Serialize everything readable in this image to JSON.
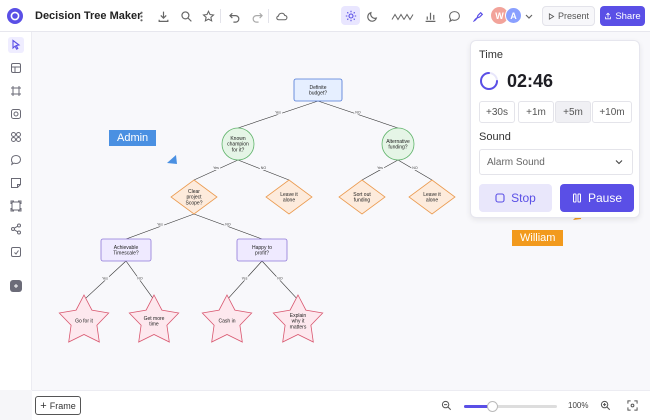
{
  "app": {
    "title": "Decision Tree Maker"
  },
  "toolbar": {
    "present_label": "Present",
    "share_label": "Share",
    "avatars": [
      {
        "initial": "W",
        "color": "#f2a39a"
      },
      {
        "initial": "A",
        "color": "#8aa0ff"
      }
    ]
  },
  "tree": {
    "nodes": [
      {
        "id": "n1",
        "shape": "rect",
        "text": [
          "Definite",
          "budget?"
        ],
        "fill": "#e6efff",
        "stroke": "#4c77d6"
      },
      {
        "id": "n2",
        "shape": "circle",
        "text": [
          "Known",
          "champion",
          "for it?"
        ],
        "fill": "#e5f5e6",
        "stroke": "#5fb36a"
      },
      {
        "id": "n3",
        "shape": "circle",
        "text": [
          "Alternative",
          "funding?"
        ],
        "fill": "#e5f5e6",
        "stroke": "#5fb36a"
      },
      {
        "id": "n4",
        "shape": "diamond",
        "text": [
          "Clear",
          "project",
          "Scope?"
        ],
        "fill": "#fdebdc",
        "stroke": "#eb9a4e"
      },
      {
        "id": "n5",
        "shape": "diamond",
        "text": [
          "Leave it",
          "alone"
        ],
        "fill": "#fdebdc",
        "stroke": "#eb9a4e"
      },
      {
        "id": "n6",
        "shape": "diamond",
        "text": [
          "Sort out",
          "funding"
        ],
        "fill": "#fdebdc",
        "stroke": "#eb9a4e"
      },
      {
        "id": "n7",
        "shape": "diamond",
        "text": [
          "Leave it",
          "alone"
        ],
        "fill": "#fdebdc",
        "stroke": "#eb9a4e"
      },
      {
        "id": "n8",
        "shape": "rect",
        "text": [
          "Achievable",
          "Timescale?"
        ],
        "fill": "#efeaff",
        "stroke": "#8f78d8"
      },
      {
        "id": "n9",
        "shape": "rect",
        "text": [
          "Happy to",
          "profit?"
        ],
        "fill": "#efeaff",
        "stroke": "#8f78d8"
      },
      {
        "id": "n10",
        "shape": "star",
        "text": [
          "Go for it"
        ],
        "fill": "#fde8ee",
        "stroke": "#d9576f"
      },
      {
        "id": "n11",
        "shape": "star",
        "text": [
          "Get more",
          "time"
        ],
        "fill": "#fde8ee",
        "stroke": "#d9576f"
      },
      {
        "id": "n12",
        "shape": "star",
        "text": [
          "Cash in"
        ],
        "fill": "#fde8ee",
        "stroke": "#d9576f"
      },
      {
        "id": "n13",
        "shape": "star",
        "text": [
          "Explain",
          "why it",
          "matters"
        ],
        "fill": "#fde8ee",
        "stroke": "#d9576f"
      }
    ],
    "edges": [
      {
        "from": "n1",
        "to": "n2",
        "label": "Yes"
      },
      {
        "from": "n1",
        "to": "n3",
        "label": "NO"
      },
      {
        "from": "n2",
        "to": "n4",
        "label": "Yes"
      },
      {
        "from": "n2",
        "to": "n5",
        "label": "NO"
      },
      {
        "from": "n3",
        "to": "n6",
        "label": "Yes"
      },
      {
        "from": "n3",
        "to": "n7",
        "label": "NO"
      },
      {
        "from": "n4",
        "to": "n8",
        "label": "Yes"
      },
      {
        "from": "n4",
        "to": "n9",
        "label": "NO"
      },
      {
        "from": "n8",
        "to": "n10",
        "label": "Yes"
      },
      {
        "from": "n8",
        "to": "n11",
        "label": "NO"
      },
      {
        "from": "n9",
        "to": "n12",
        "label": "Yes"
      },
      {
        "from": "n9",
        "to": "n13",
        "label": "NO"
      }
    ]
  },
  "cursors": [
    {
      "name": "Admin",
      "color": "#4a90e2"
    },
    {
      "name": "William",
      "color": "#f29a1d"
    }
  ],
  "timer": {
    "time_label": "Time",
    "time_value": "02:46",
    "increments": [
      "+30s",
      "+1m",
      "+5m",
      "+10m"
    ],
    "selected_increment": "+5m",
    "sound_label": "Sound",
    "sound_value": "Alarm Sound",
    "stop_label": "Stop",
    "pause_label": "Pause",
    "accent": "#5a4fe6"
  },
  "bottom": {
    "frame_label": "Frame",
    "zoom": "100%",
    "zoom_fraction": 0.3
  }
}
